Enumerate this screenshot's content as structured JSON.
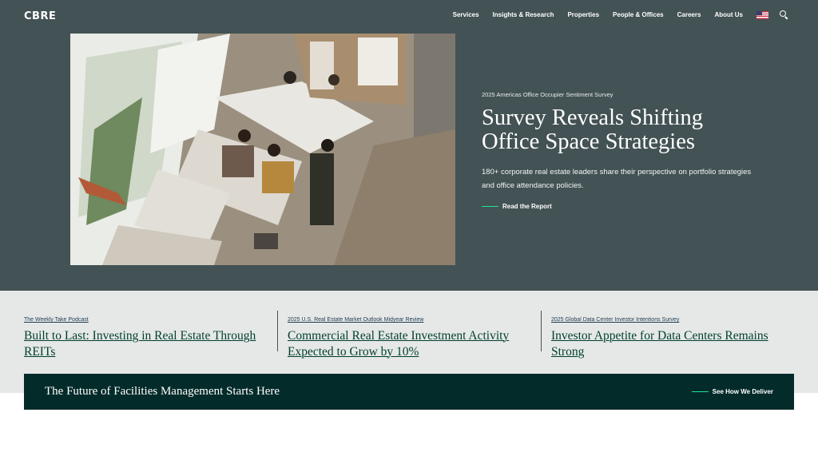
{
  "header": {
    "logo": "CBRE",
    "nav": [
      "Services",
      "Insights & Research",
      "Properties",
      "People & Offices",
      "Careers",
      "About Us"
    ],
    "locale_icon": "us-flag-icon",
    "search_icon": "search-icon"
  },
  "hero": {
    "image_alt": "Overhead view of people working at desks in a bright office",
    "eyebrow": "2025 Americas Office Occupier Sentiment Survey",
    "title_line1": "Survey Reveals Shifting",
    "title_line2": "Office Space Strategies",
    "description": "180+ corporate real estate leaders share their perspective on portfolio strategies and office attendance policies.",
    "cta": "Read the Report"
  },
  "features": [
    {
      "eyebrow": "The Weekly Take Podcast",
      "title": "Built to Last: Investing in Real Estate Through REITs"
    },
    {
      "eyebrow": "2025 U.S. Real Estate Market Outlook Midyear Review",
      "title": "Commercial Real Estate Investment Activity Expected to Grow by 10%"
    },
    {
      "eyebrow": "2025 Global Data Center Investor Intentions Survey",
      "title": "Investor Appetite for Data Centers Remains Strong"
    }
  ],
  "banner": {
    "title": "The Future of Facilities Management Starts Here",
    "cta": "See How We Deliver"
  },
  "colors": {
    "hero_bg": "#435254",
    "accent": "#17e88f",
    "features_bg": "#e6e8e8",
    "link": "#003f2d",
    "banner_bg": "#032b2a"
  }
}
